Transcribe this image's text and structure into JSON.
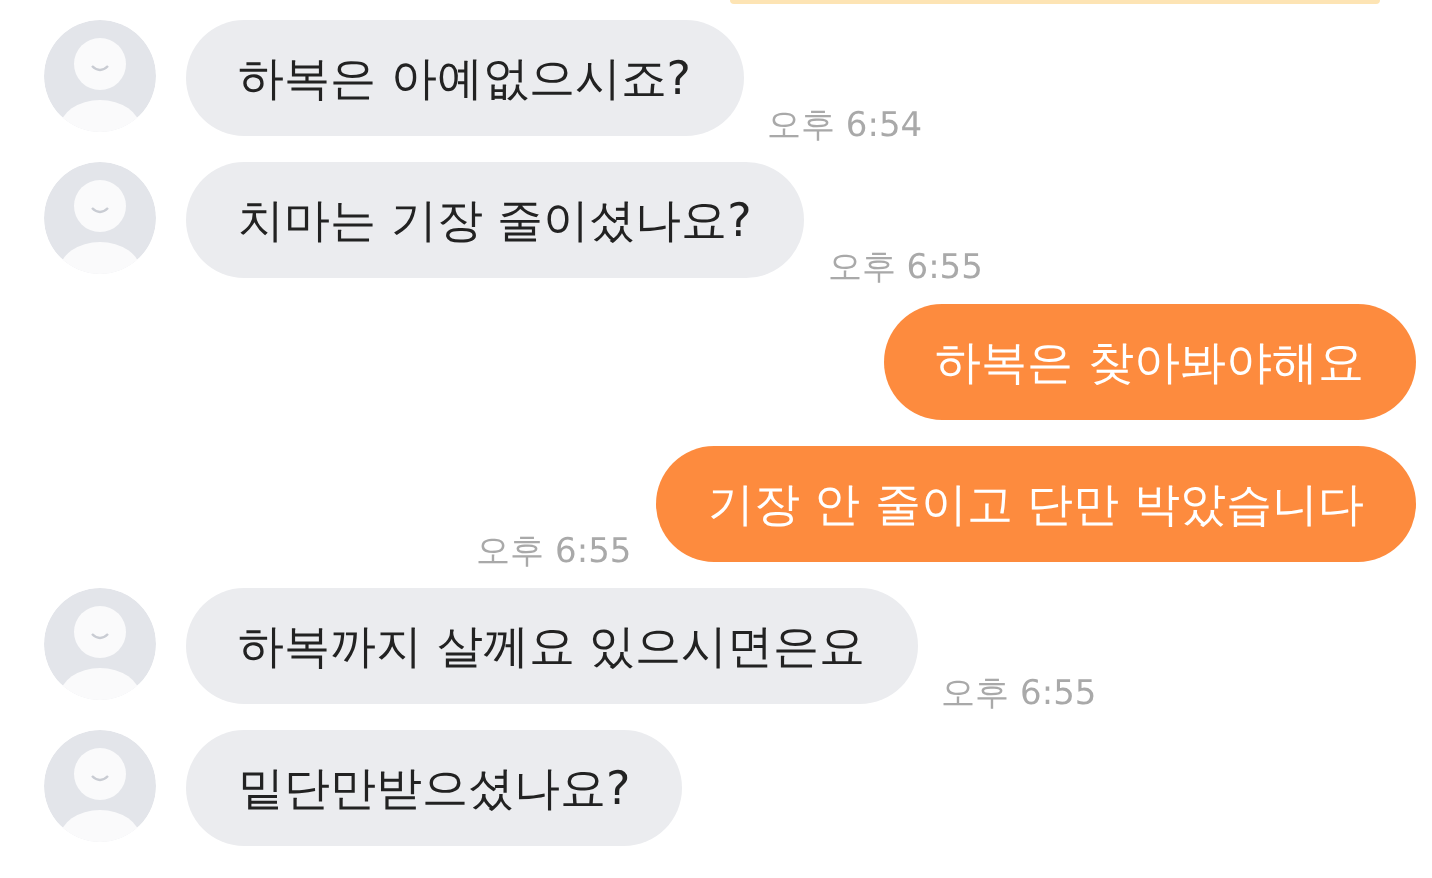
{
  "messages": [
    {
      "kind": "received",
      "text": "하복은 아예없으시죠?",
      "time": "오후 6:54"
    },
    {
      "kind": "received",
      "text": "치마는 기장 줄이셨나요?",
      "time": "오후 6:55"
    },
    {
      "kind": "sent",
      "text": "하복은 찾아봐야해요"
    },
    {
      "kind": "sent",
      "text": "기장 안 줄이고 단만 박았습니다",
      "time": "오후 6:55"
    },
    {
      "kind": "received",
      "text": "하복까지 살께요 있으시면은요",
      "time": "오후 6:55"
    },
    {
      "kind": "received",
      "text": "밑단만받으셨나요?"
    }
  ]
}
